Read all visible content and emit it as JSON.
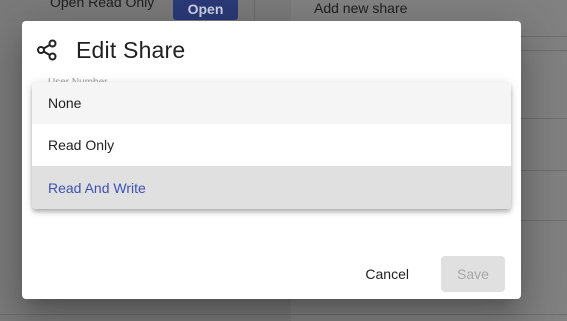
{
  "background": {
    "open_read_only_label": "Open Read Only",
    "open_button_label": "Open",
    "add_new_share_label": "Add new share"
  },
  "dialog": {
    "title": "Edit Share",
    "icon": "share-icon",
    "field_label": "User Number",
    "cancel_label": "Cancel",
    "save_label": "Save",
    "save_enabled": false
  },
  "menu": {
    "options": [
      {
        "label": "None",
        "state": "hover"
      },
      {
        "label": "Read Only",
        "state": "normal"
      },
      {
        "label": "Read And Write",
        "state": "selected"
      }
    ]
  },
  "colors": {
    "accent": "#3f51b5",
    "primary_button": "#2b3a78",
    "disabled_button": "#e0e0e0"
  }
}
